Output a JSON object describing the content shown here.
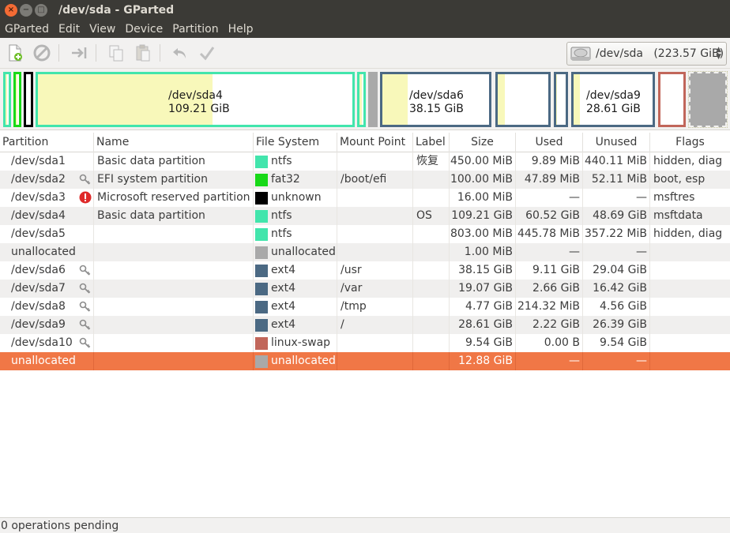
{
  "window": {
    "title": "/dev/sda - GParted",
    "close_glyph": "×",
    "min_glyph": "−",
    "max_glyph": "□"
  },
  "menu": [
    "GParted",
    "Edit",
    "View",
    "Device",
    "Partition",
    "Help"
  ],
  "toolbar": {
    "icons": [
      "new-partition-icon",
      "delete-icon",
      "resize-move-icon",
      "copy-icon",
      "paste-icon",
      "undo-icon",
      "apply-icon"
    ],
    "device": "/dev/sda   (223.57 GiB)"
  },
  "map": {
    "sda4": {
      "name": "/dev/sda4",
      "size": "109.21 GiB"
    },
    "sda6": {
      "name": "/dev/sda6",
      "size": "38.15 GiB"
    },
    "sda9": {
      "name": "/dev/sda9",
      "size": "28.61 GiB"
    }
  },
  "columns": [
    "Partition",
    "Name",
    "File System",
    "Mount Point",
    "Label",
    "Size",
    "Used",
    "Unused",
    "Flags"
  ],
  "rows": [
    {
      "partition": "/dev/sda1",
      "name": "Basic data partition",
      "fs": "ntfs",
      "fs_color": "#42e5ac",
      "mount": "",
      "label": "恢复",
      "size": "450.00 MiB",
      "used": "9.89 MiB",
      "unused": "440.11 MiB",
      "flags": "hidden, diag",
      "icon": ""
    },
    {
      "partition": "/dev/sda2",
      "name": "EFI system partition",
      "fs": "fat32",
      "fs_color": "#18d918",
      "mount": "/boot/efi",
      "label": "",
      "size": "100.00 MiB",
      "used": "47.89 MiB",
      "unused": "52.11 MiB",
      "flags": "boot, esp",
      "icon": "key"
    },
    {
      "partition": "/dev/sda3",
      "name": "Microsoft reserved partition",
      "fs": "unknown",
      "fs_color": "#000000",
      "mount": "",
      "label": "",
      "size": "16.00 MiB",
      "used": "—",
      "unused": "—",
      "flags": "msftres",
      "icon": "warn"
    },
    {
      "partition": "/dev/sda4",
      "name": "Basic data partition",
      "fs": "ntfs",
      "fs_color": "#42e5ac",
      "mount": "",
      "label": "OS",
      "size": "109.21 GiB",
      "used": "60.52 GiB",
      "unused": "48.69 GiB",
      "flags": "msftdata",
      "icon": ""
    },
    {
      "partition": "/dev/sda5",
      "name": "",
      "fs": "ntfs",
      "fs_color": "#42e5ac",
      "mount": "",
      "label": "",
      "size": "803.00 MiB",
      "used": "445.78 MiB",
      "unused": "357.22 MiB",
      "flags": "hidden, diag",
      "icon": ""
    },
    {
      "partition": "unallocated",
      "name": "",
      "fs": "unallocated",
      "fs_color": "#a9a9a9",
      "mount": "",
      "label": "",
      "size": "1.00 MiB",
      "used": "—",
      "unused": "—",
      "flags": "",
      "icon": ""
    },
    {
      "partition": "/dev/sda6",
      "name": "",
      "fs": "ext4",
      "fs_color": "#4b6983",
      "mount": "/usr",
      "label": "",
      "size": "38.15 GiB",
      "used": "9.11 GiB",
      "unused": "29.04 GiB",
      "flags": "",
      "icon": "key"
    },
    {
      "partition": "/dev/sda7",
      "name": "",
      "fs": "ext4",
      "fs_color": "#4b6983",
      "mount": "/var",
      "label": "",
      "size": "19.07 GiB",
      "used": "2.66 GiB",
      "unused": "16.42 GiB",
      "flags": "",
      "icon": "key"
    },
    {
      "partition": "/dev/sda8",
      "name": "",
      "fs": "ext4",
      "fs_color": "#4b6983",
      "mount": "/tmp",
      "label": "",
      "size": "4.77 GiB",
      "used": "214.32 MiB",
      "unused": "4.56 GiB",
      "flags": "",
      "icon": "key"
    },
    {
      "partition": "/dev/sda9",
      "name": "",
      "fs": "ext4",
      "fs_color": "#4b6983",
      "mount": "/",
      "label": "",
      "size": "28.61 GiB",
      "used": "2.22 GiB",
      "unused": "26.39 GiB",
      "flags": "",
      "icon": "key"
    },
    {
      "partition": "/dev/sda10",
      "name": "",
      "fs": "linux-swap",
      "fs_color": "#c1665a",
      "mount": "",
      "label": "",
      "size": "9.54 GiB",
      "used": "0.00 B",
      "unused": "9.54 GiB",
      "flags": "",
      "icon": "key"
    },
    {
      "partition": "unallocated",
      "name": "",
      "fs": "unallocated",
      "fs_color": "#a9a9a9",
      "mount": "",
      "label": "",
      "size": "12.88 GiB",
      "used": "—",
      "unused": "—",
      "flags": "",
      "icon": "",
      "selected": true
    }
  ],
  "status": "0 operations pending"
}
